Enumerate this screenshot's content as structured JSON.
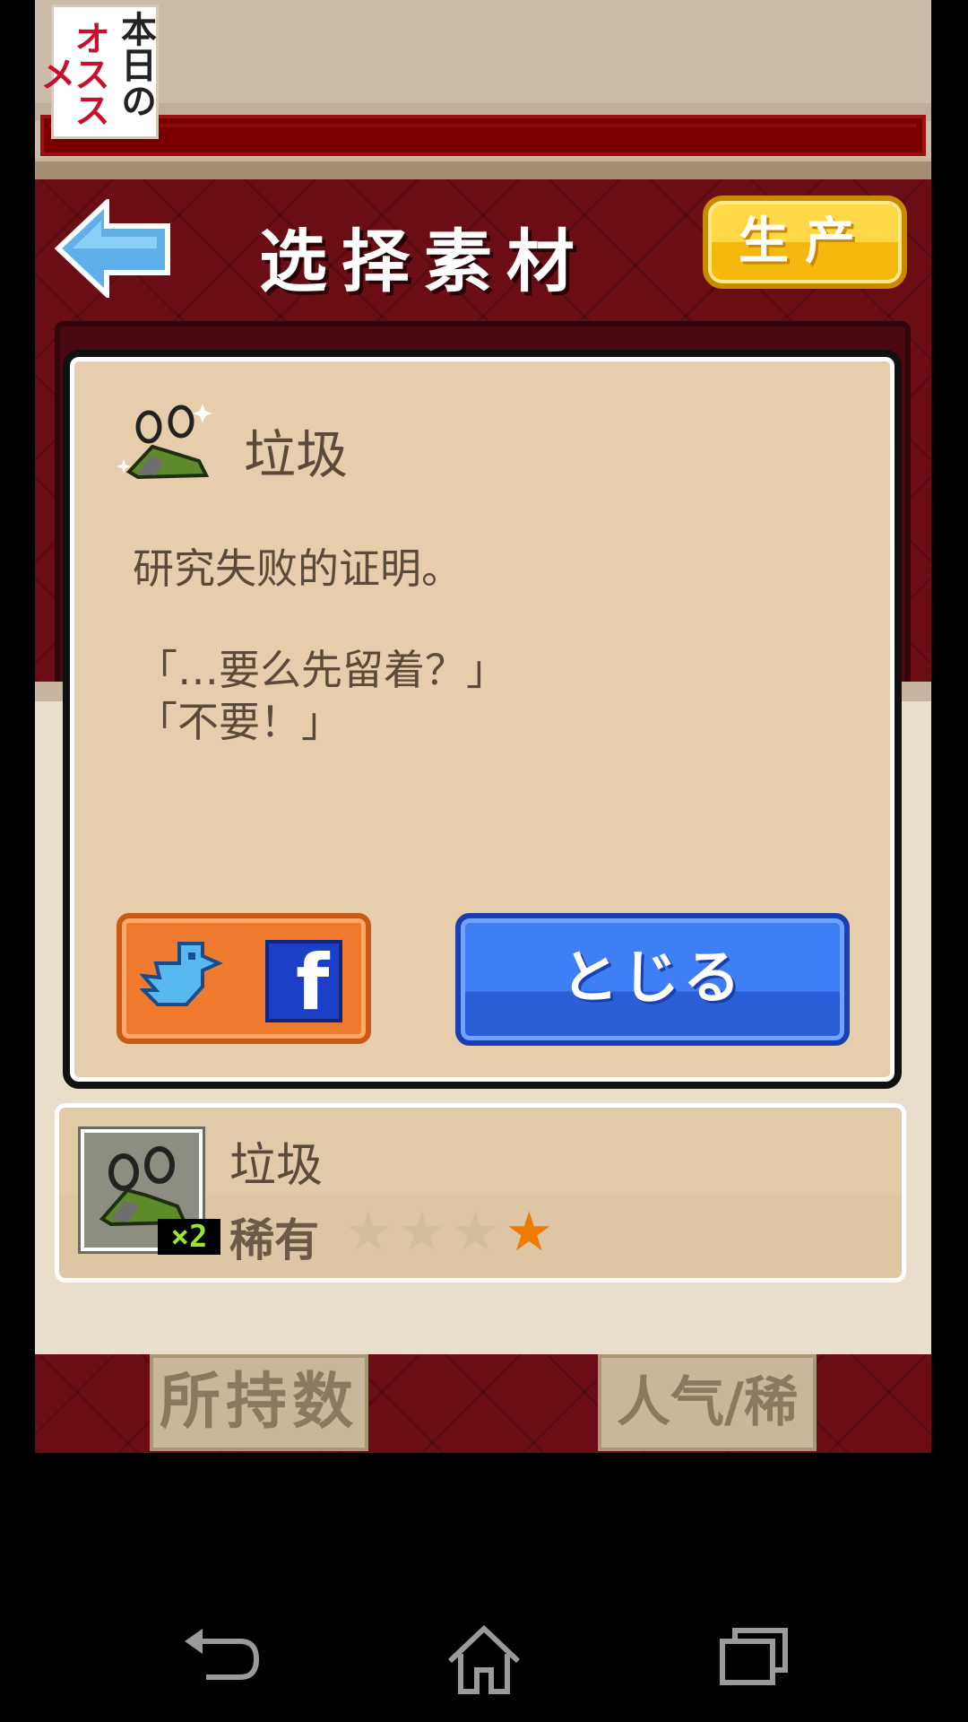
{
  "banner": {
    "logo_left": "オススメ",
    "logo_right": "本日の"
  },
  "header": {
    "title": "选择素材",
    "produce_label": "生产"
  },
  "dialog": {
    "item_name": "垃圾",
    "description": "研究失败的证明。",
    "quote_1": "「…要么先留着？」",
    "quote_2": "「不要！」",
    "close_label": "とじる"
  },
  "item": {
    "name": "垃圾",
    "rarity_label": "稀有",
    "rarity_stars": 1,
    "rarity_max": 4,
    "quantity": "×2"
  },
  "sort": {
    "by_count": "所持数",
    "by_popularity": "人气/稀有"
  },
  "colors": {
    "header_red": "#6b0d14",
    "produce_yellow": "#f5b80f",
    "close_blue": "#2a5fd8",
    "share_orange": "#f07a2e",
    "star_orange": "#ee7a00"
  }
}
